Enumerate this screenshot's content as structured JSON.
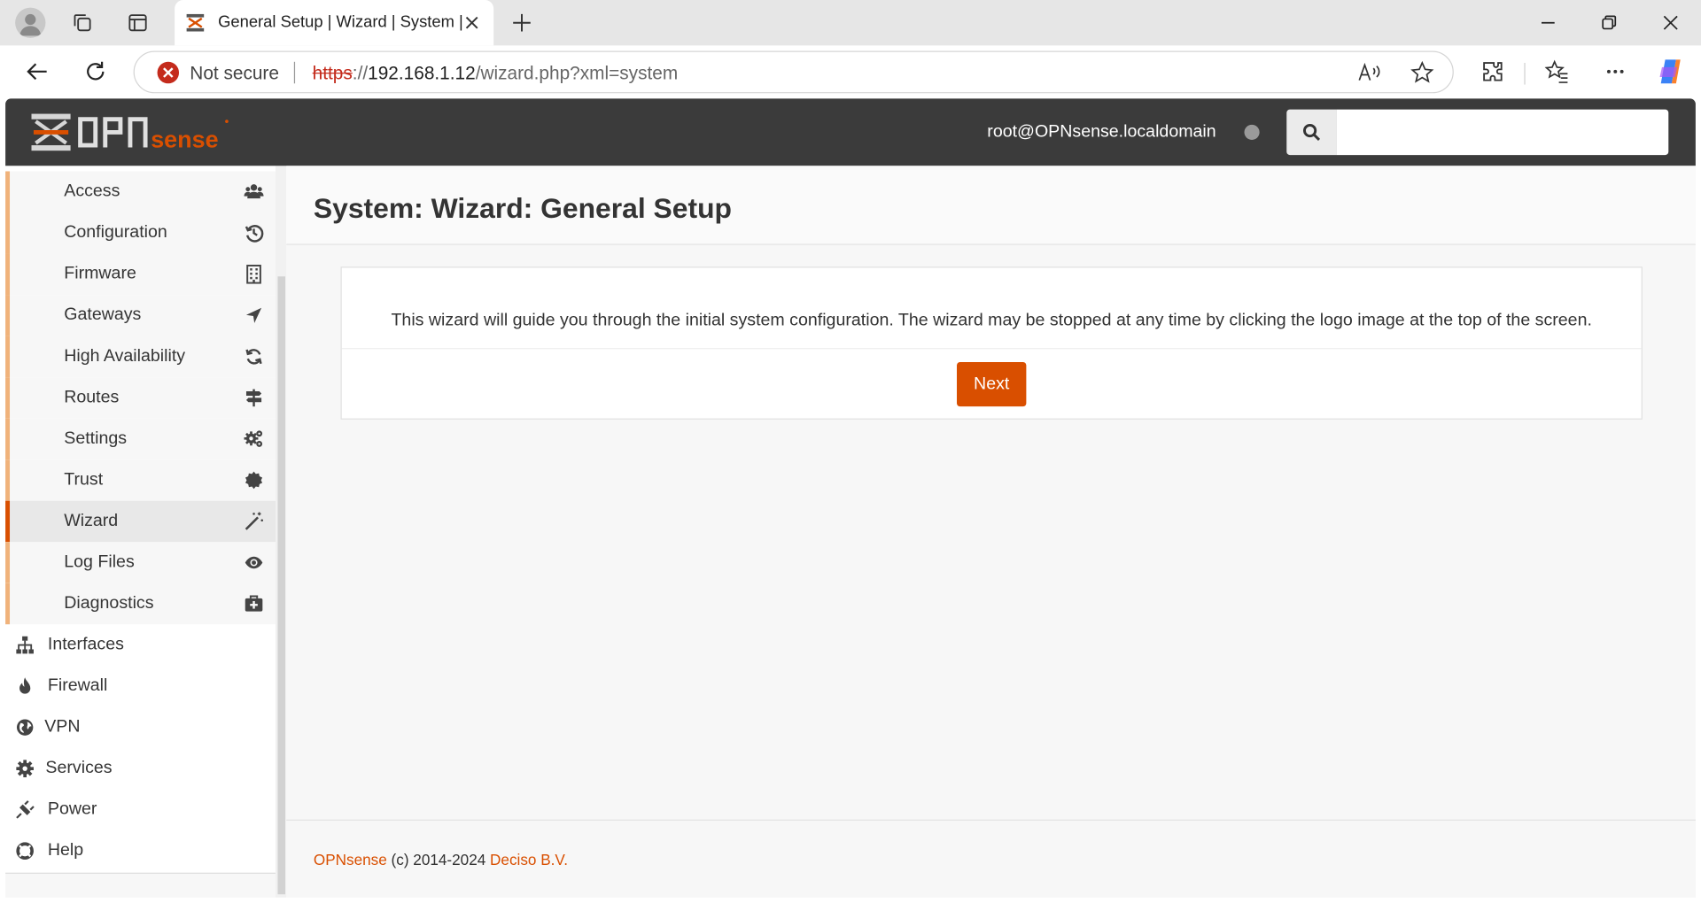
{
  "browser": {
    "tab_title": "General Setup | Wizard | System |",
    "security_label": "Not secure",
    "url_scheme": "https",
    "url_host": "192.168.1.12",
    "url_path": "/wizard.php?xml=system",
    "url_scheme_sep": "://"
  },
  "header": {
    "logo_text": "OPNsense",
    "user": "root@OPNsense.localdomain",
    "search_placeholder": ""
  },
  "sidebar": {
    "system_items": [
      {
        "label": "Access",
        "icon": "users-icon"
      },
      {
        "label": "Configuration",
        "icon": "history-icon"
      },
      {
        "label": "Firmware",
        "icon": "building-icon"
      },
      {
        "label": "Gateways",
        "icon": "location-arrow-icon"
      },
      {
        "label": "High Availability",
        "icon": "refresh-icon"
      },
      {
        "label": "Routes",
        "icon": "map-signs-icon"
      },
      {
        "label": "Settings",
        "icon": "cogs-icon"
      },
      {
        "label": "Trust",
        "icon": "certificate-icon"
      },
      {
        "label": "Wizard",
        "icon": "magic-wand-icon",
        "active": true
      },
      {
        "label": "Log Files",
        "icon": "eye-icon"
      },
      {
        "label": "Diagnostics",
        "icon": "medkit-icon"
      }
    ],
    "top_items": [
      {
        "label": "Interfaces",
        "icon": "sitemap-icon"
      },
      {
        "label": "Firewall",
        "icon": "fire-icon"
      },
      {
        "label": "VPN",
        "icon": "globe-icon"
      },
      {
        "label": "Services",
        "icon": "cog-icon"
      },
      {
        "label": "Power",
        "icon": "plug-icon"
      },
      {
        "label": "Help",
        "icon": "life-ring-icon"
      }
    ]
  },
  "main": {
    "title": "System: Wizard: General Setup",
    "description": "This wizard will guide you through the initial system configuration. The wizard may be stopped at any time by clicking the logo image at the top of the screen.",
    "next_label": "Next"
  },
  "footer": {
    "brand": "OPNsense",
    "copyright": "(c) 2014-2024",
    "company": "Deciso B.V."
  },
  "colors": {
    "accent": "#d94f00",
    "header_bg": "#3b3b3b",
    "submenu_border": "#f0b27a"
  }
}
